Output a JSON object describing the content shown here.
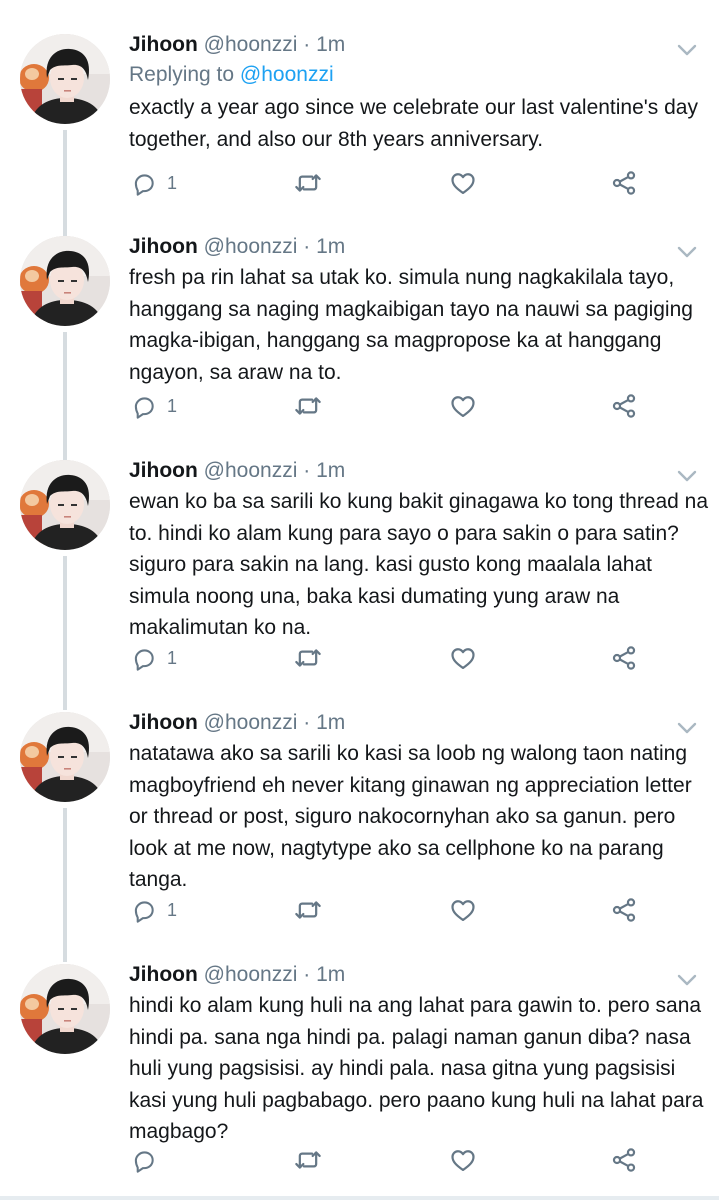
{
  "tweets": [
    {
      "name": "Jihoon",
      "handle": "@hoonzzi",
      "dot": "·",
      "time": "1m",
      "replying_prefix": "Replying to",
      "replying_handle": "@hoonzzi",
      "body": "exactly a year ago since we celebrate our last valentine's day together, and also our 8th years anniversary.",
      "reply_count": "1"
    },
    {
      "name": "Jihoon",
      "handle": "@hoonzzi",
      "dot": "·",
      "time": "1m",
      "body": "fresh pa rin lahat sa utak ko. simula nung nagkakilala tayo, hanggang sa naging magkaibigan tayo na nauwi sa pagiging magka-ibigan, hanggang sa magpropose ka at hanggang ngayon, sa araw na to.",
      "reply_count": "1"
    },
    {
      "name": "Jihoon",
      "handle": "@hoonzzi",
      "dot": "·",
      "time": "1m",
      "body": "ewan ko ba sa sarili ko kung bakit ginagawa ko tong thread na to. hindi ko alam kung para sayo o para sakin o para satin? siguro para sakin na lang. kasi gusto kong maalala lahat simula noong una, baka kasi dumating yung araw na makalimutan ko na.",
      "reply_count": "1"
    },
    {
      "name": "Jihoon",
      "handle": "@hoonzzi",
      "dot": "·",
      "time": "1m",
      "body": "natatawa ako sa sarili ko kasi sa loob ng walong taon nating magboyfriend eh never kitang ginawan ng appreciation letter or thread or post, siguro nakocornyhan ako sa ganun. pero look at me now, nagtytype ako sa cellphone ko na parang tanga.",
      "reply_count": "1"
    },
    {
      "name": "Jihoon",
      "handle": "@hoonzzi",
      "dot": "·",
      "time": "1m",
      "body": "hindi ko alam kung huli na ang lahat para gawin to. pero sana hindi pa. sana nga hindi pa. palagi naman ganun diba? nasa huli yung pagsisisi. ay hindi pala. nasa gitna yung pagsisisi kasi yung huli pagbabago. pero paano kung huli na lahat para magbago?",
      "reply_count": ""
    }
  ],
  "icons": {
    "reply": "reply-icon",
    "retweet": "retweet-icon",
    "like": "heart-icon",
    "share": "share-icon",
    "menu": "chevron-down-icon"
  },
  "colors": {
    "text": "#14171a",
    "secondary": "#657786",
    "link": "#1da1f2",
    "thread_line": "#d6dce0"
  }
}
